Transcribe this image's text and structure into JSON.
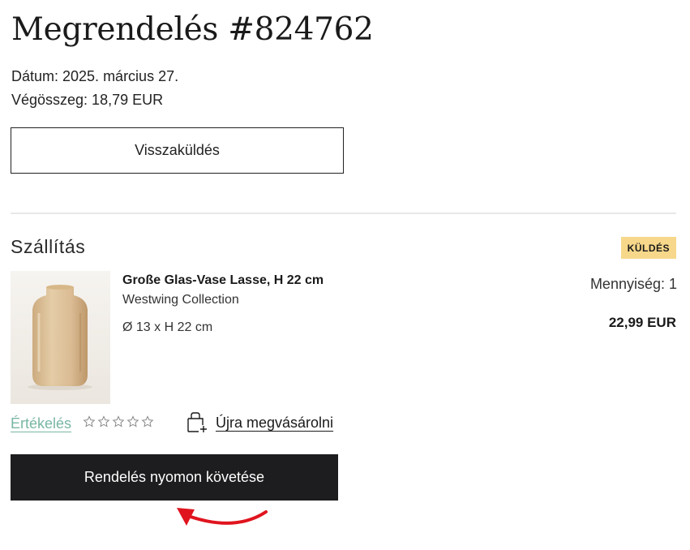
{
  "order": {
    "title": "Megrendelés #824762",
    "date_line": "Dátum: 2025. március 27.",
    "total_line": "Végösszeg: 18,79 EUR"
  },
  "actions": {
    "return_label": "Visszaküldés",
    "track_label": "Rendelés nyomon követése"
  },
  "shipment": {
    "section_title": "Szállítás",
    "status_badge": "KÜLDÉS",
    "status_color": "#f7d88a"
  },
  "product": {
    "name": "Große Glas-Vase Lasse, H 22 cm",
    "brand": "Westwing Collection",
    "dimensions": "Ø 13 x H 22 cm",
    "quantity_line": "Mennyiség: 1",
    "price": "22,99 EUR",
    "image_icon": "glass-vase-image"
  },
  "review": {
    "link_label": "Értékelés",
    "link_color": "#79b6a5",
    "rating": 0,
    "max_rating": 5
  },
  "rebuy": {
    "label": "Újra megvásárolni",
    "icon": "bag-plus-icon"
  },
  "annotation": {
    "arrow_color": "#e0141e",
    "icon": "curved-arrow-icon"
  }
}
